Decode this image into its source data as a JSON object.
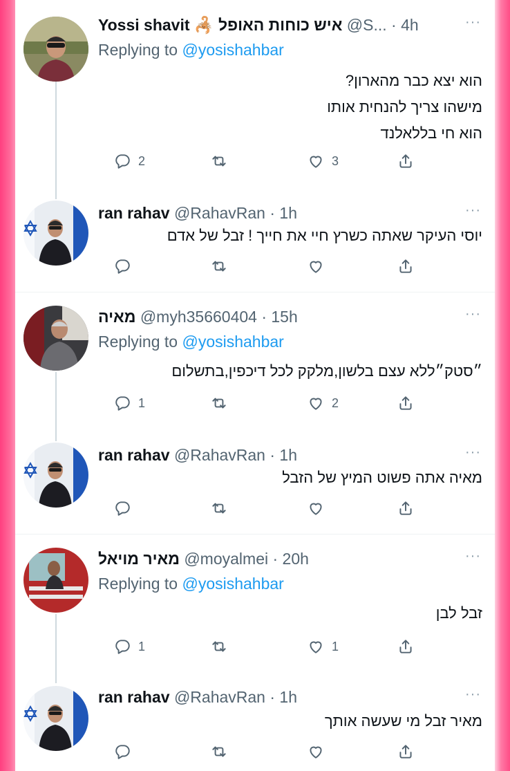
{
  "tweets": [
    {
      "name": "Yossi shavit 🦂 איש כוחות האופל",
      "handle_time": "@S... · 4h",
      "reply_prefix": "Replying to",
      "reply_handle": "@yosishahbar",
      "text": "הוא יצא כבר מהארון?\nמישהו צריך להנחית אותו\nהוא חי בללאלנד",
      "replies": "2",
      "retweets": "",
      "likes": "3"
    },
    {
      "name": "ran rahav",
      "handle_time": "@RahavRan · 1h",
      "text": "יוסי העיקר שאתה כשרץ חיי את חייך ! זבל של אדם",
      "replies": "",
      "retweets": "",
      "likes": ""
    },
    {
      "name": "מאיה",
      "handle_time": "@myh35660404 · 15h",
      "reply_prefix": "Replying to",
      "reply_handle": "@yosishahbar",
      "text": "״סטק״ללא עצם בלשון,מלקק לכל דיכפין,בתשלום",
      "replies": "1",
      "retweets": "",
      "likes": "2"
    },
    {
      "name": "ran rahav",
      "handle_time": "@RahavRan · 1h",
      "text": "מאיה   אתה פשוט המיץ של הזבל",
      "replies": "",
      "retweets": "",
      "likes": ""
    },
    {
      "name": "מאיר מויאל",
      "handle_time": "@moyalmei · 20h",
      "reply_prefix": "Replying to",
      "reply_handle": "@yosishahbar",
      "text": "זבל לבן",
      "replies": "1",
      "retweets": "",
      "likes": "1"
    },
    {
      "name": "ran rahav",
      "handle_time": "@RahavRan · 1h",
      "text": "מאיר זבל מי שעשה אותך",
      "replies": "",
      "retweets": "",
      "likes": ""
    }
  ],
  "more_label": "···",
  "colors": {
    "link": "#1d9bf0",
    "secondary": "#536471",
    "frame": "#ff5a8f",
    "thread": "#cfd9de"
  },
  "icons": [
    "reply-icon",
    "retweet-icon",
    "like-icon",
    "share-icon",
    "more-icon"
  ]
}
